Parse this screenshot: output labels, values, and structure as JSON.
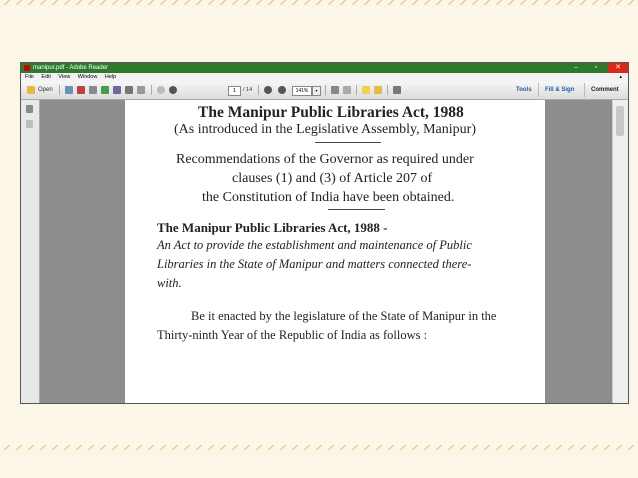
{
  "window": {
    "title": "manipur.pdf - Adobe Reader",
    "controls": {
      "minimize": "–",
      "maximize": "▫",
      "close": "✕"
    }
  },
  "menu": {
    "items": [
      "File",
      "Edit",
      "View",
      "Window",
      "Help"
    ],
    "collapse": "▴"
  },
  "toolbar": {
    "open_label": "Open",
    "page_current": "1",
    "page_total": "/ 14",
    "zoom": "141%",
    "zoom_dropdown": "▾",
    "tabs": {
      "tools": "Tools",
      "fill_sign": "Fill & Sign",
      "comment": "Comment"
    }
  },
  "document": {
    "title": "The Manipur Public Libraries Act, 1988",
    "subtitle": "(As introduced in the Legislative Assembly, Manipur)",
    "recommendation": [
      "Recommendations of the Governor as required under",
      "clauses (1) and (3) of Article 207 of",
      "the Constitution of India have been obtained."
    ],
    "act_heading": "The Manipur Public Libraries Act, 1988 -",
    "act_description": [
      "An Act to provide the establishment and maintenance of Public",
      "Libraries in the State of Manipur and matters connected there-",
      "with."
    ],
    "enactment": [
      "Be it enacted by the legislature of the State of Manipur in the",
      "Thirty-ninth Year of the Republic of India as follows :"
    ]
  }
}
